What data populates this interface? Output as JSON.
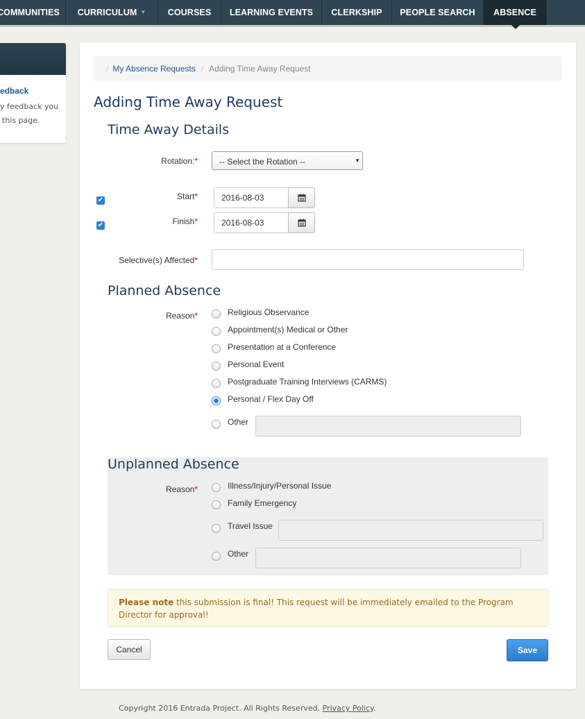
{
  "nav": {
    "items": [
      "COMMUNITIES",
      "CURRICULUM",
      "COURSES",
      "LEARNING EVENTS",
      "CLERKSHIP",
      "PEOPLE SEARCH",
      "ABSENCE"
    ],
    "active": "ABSENCE"
  },
  "sidebar": {
    "link_text": "edback",
    "text_line1": "y feedback you",
    "text_line2": "this page."
  },
  "breadcrumb": {
    "link": "My Absence Requests",
    "current": "Adding Time Away Request"
  },
  "page_title": "Adding Time Away Request",
  "time_away": {
    "heading": "Time Away Details",
    "rotation_label": "Rotation:",
    "rotation_value": "-- Select the Rotation --",
    "start_label": "Start",
    "start_value": "2016-08-03",
    "start_checked": true,
    "finish_label": "Finish",
    "finish_value": "2016-08-03",
    "finish_checked": true,
    "selectives_label": "Selective(s) Affected",
    "selectives_value": ""
  },
  "planned": {
    "heading": "Planned Absence",
    "reason_label": "Reason",
    "options": [
      "Religious Observance",
      "Appointment(s) Medical or Other",
      "Presentation at a Conference",
      "Personal Event",
      "Postgraduate Training Interviews (CARMS)",
      "Personal / Flex Day Off",
      "Other"
    ],
    "selected": "Personal / Flex Day Off",
    "other_value": ""
  },
  "unplanned": {
    "heading": "Unplanned Absence",
    "reason_label": "Reason",
    "options": [
      "Illness/Injury/Personal Issue",
      "Family Emergency",
      "Travel Issue",
      "Other"
    ],
    "travel_value": "",
    "other_value": ""
  },
  "alert": {
    "strong": "Please note",
    "text": " this submission is final! This request will be immediately emailed to the Program Director for approval!"
  },
  "buttons": {
    "cancel": "Cancel",
    "save": "Save"
  },
  "footer": {
    "text": "Copyright 2016 Entrada Project. All Rights Reserved. ",
    "link": "Privacy Policy",
    "end": "."
  },
  "colors": {
    "nav_bg": "#2f4553",
    "accent": "#2e7fd6",
    "heading": "#1d3a5f",
    "required": "#cc0000"
  }
}
